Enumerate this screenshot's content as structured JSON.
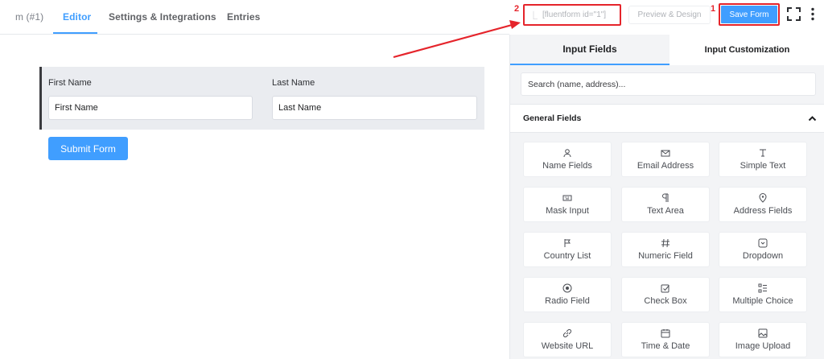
{
  "nav": {
    "prefix": "m (#1)",
    "tabs": [
      "Editor",
      "Settings & Integrations",
      "Entries"
    ]
  },
  "form": {
    "fields": [
      {
        "label": "First Name",
        "value": "First Name"
      },
      {
        "label": "Last Name",
        "value": "Last Name"
      }
    ],
    "submit_label": "Submit Form"
  },
  "toolbar": {
    "shortcode": "[fluentform id=\"1\"]",
    "marker_shortcode": "2",
    "preview_label": "Preview & Design",
    "save_label": "Save Form",
    "marker_save": "1"
  },
  "panel": {
    "tabs": [
      "Input Fields",
      "Input Customization"
    ],
    "search_placeholder": "Search (name, address)...",
    "section_title": "General Fields",
    "items": [
      {
        "label": "Name Fields",
        "icon": "user-icon"
      },
      {
        "label": "Email Address",
        "icon": "envelope-icon"
      },
      {
        "label": "Simple Text",
        "icon": "text-cursor-icon"
      },
      {
        "label": "Mask Input",
        "icon": "keyboard-icon"
      },
      {
        "label": "Text Area",
        "icon": "paragraph-icon"
      },
      {
        "label": "Address Fields",
        "icon": "map-pin-icon"
      },
      {
        "label": "Country List",
        "icon": "flag-icon"
      },
      {
        "label": "Numeric Field",
        "icon": "hash-icon"
      },
      {
        "label": "Dropdown",
        "icon": "dropdown-icon"
      },
      {
        "label": "Radio Field",
        "icon": "radio-icon"
      },
      {
        "label": "Check Box",
        "icon": "checkbox-icon"
      },
      {
        "label": "Multiple Choice",
        "icon": "list-icon"
      },
      {
        "label": "Website URL",
        "icon": "link-icon"
      },
      {
        "label": "Time & Date",
        "icon": "calendar-icon"
      },
      {
        "label": "Image Upload",
        "icon": "image-icon"
      }
    ]
  },
  "colors": {
    "accent": "#409eff",
    "highlight": "#e5242b"
  }
}
